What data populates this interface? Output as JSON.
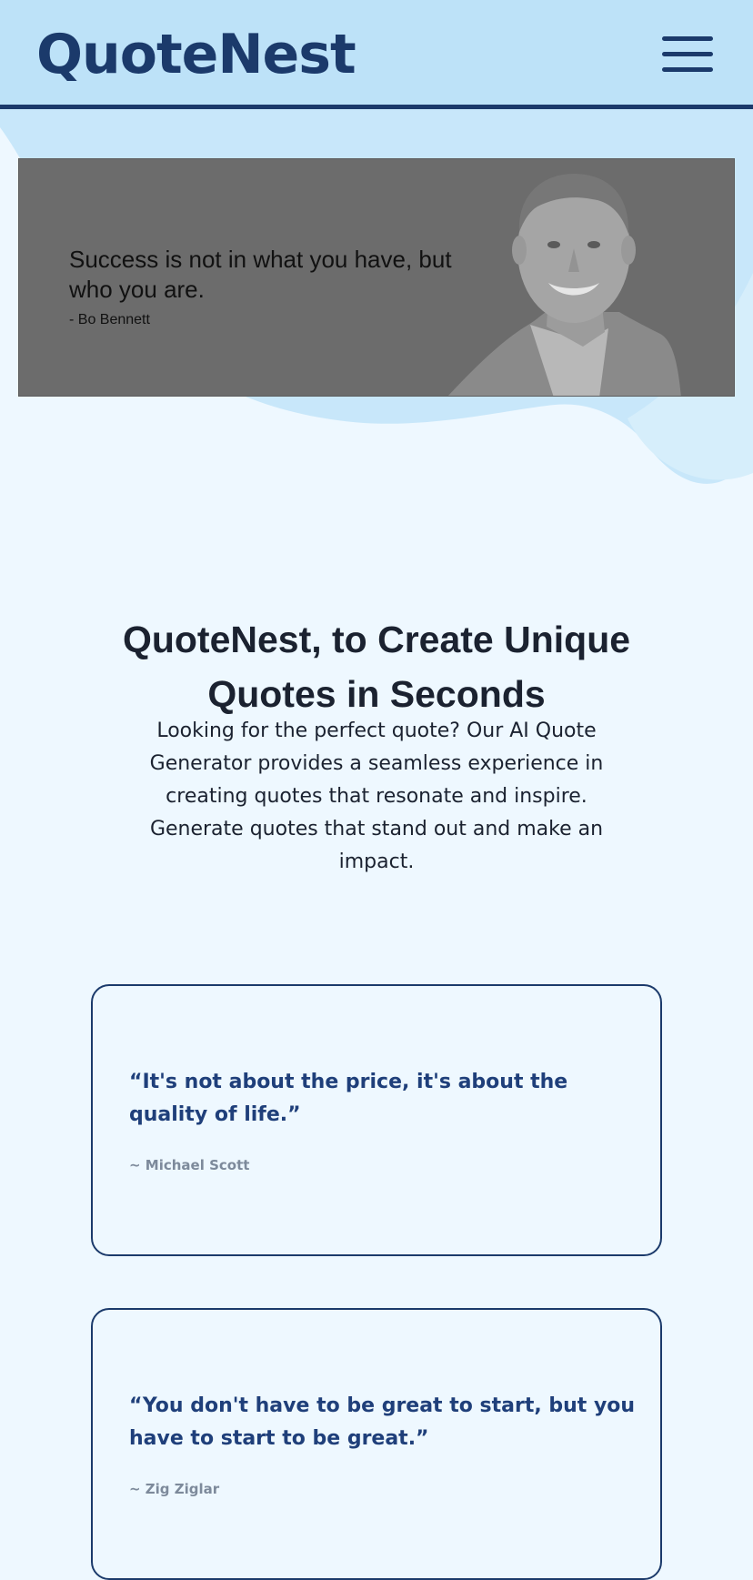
{
  "header": {
    "logo": "QuoteNest",
    "menu_icon": "hamburger-menu-icon"
  },
  "hero": {
    "quote": "Success is not in what you have, but who you are.",
    "author": "- Bo Bennett"
  },
  "intro": {
    "title": "QuoteNest, to Create Unique Quotes in Seconds",
    "text": "Looking for the perfect quote? Our AI Quote Generator provides a seamless experience in creating quotes that resonate and inspire. Generate quotes that stand out and make an impact."
  },
  "quotes": [
    {
      "text": "“It's not about the price, it's about the quality of life.”",
      "author": "~ Michael Scott"
    },
    {
      "text": "“You don't have to be great to start, but you have to start to be great.”",
      "author": "~ Zig Ziglar"
    }
  ],
  "colors": {
    "brand": "#1b3a6b",
    "header_bg": "#bde2f8",
    "page_bg": "#eef8ff",
    "quote_text": "#1f3f7a",
    "author_text": "#7d8a9b"
  }
}
